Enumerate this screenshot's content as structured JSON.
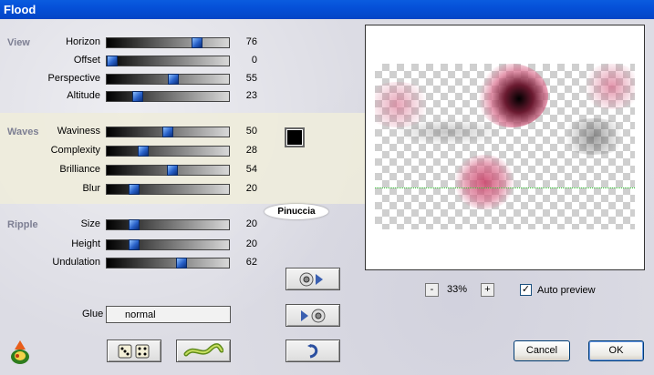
{
  "window": {
    "title": "Flood"
  },
  "sections": {
    "view": {
      "title": "View",
      "sliders": [
        {
          "label": "Horizon",
          "value": 76
        },
        {
          "label": "Offset",
          "value": 0
        },
        {
          "label": "Perspective",
          "value": 55
        },
        {
          "label": "Altitude",
          "value": 23
        }
      ]
    },
    "waves": {
      "title": "Waves",
      "sliders": [
        {
          "label": "Waviness",
          "value": 50
        },
        {
          "label": "Complexity",
          "value": 28
        },
        {
          "label": "Brilliance",
          "value": 54
        },
        {
          "label": "Blur",
          "value": 20
        }
      ],
      "color": "#000000"
    },
    "ripple": {
      "title": "Ripple",
      "sliders": [
        {
          "label": "Size",
          "value": 20
        },
        {
          "label": "Height",
          "value": 20
        },
        {
          "label": "Undulation",
          "value": 62
        }
      ]
    }
  },
  "badge": "Pinuccia",
  "glue": {
    "label": "Glue",
    "value": "normal"
  },
  "zoom": {
    "minus": "-",
    "value": "33%",
    "plus": "+"
  },
  "auto_preview": {
    "label": "Auto preview",
    "checked": true,
    "mark": "✓"
  },
  "buttons": {
    "cancel": "Cancel",
    "ok": "OK"
  },
  "colors": {
    "title_bar": "#0553d8",
    "slider_thumb": "#2860c8",
    "section_label": "#7d7f93",
    "preview_pink": "#d86a8a"
  }
}
